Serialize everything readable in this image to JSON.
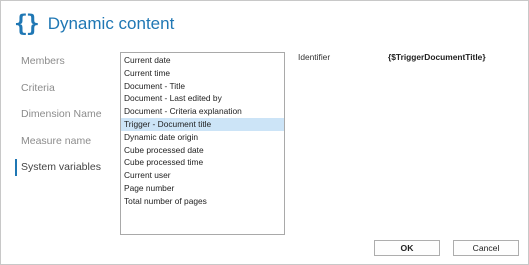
{
  "header": {
    "icon": "curly-braces-icon",
    "icon_glyph": "{}",
    "title": "Dynamic content",
    "accent_color": "#1f77b4"
  },
  "nav": {
    "items": [
      {
        "label": "Members"
      },
      {
        "label": "Criteria"
      },
      {
        "label": "Dimension Name"
      },
      {
        "label": "Measure name"
      },
      {
        "label": "System variables",
        "active": true
      }
    ]
  },
  "variables": {
    "selected_index": 5,
    "items": [
      {
        "label": "Current date"
      },
      {
        "label": "Current time"
      },
      {
        "label": "Document - Title"
      },
      {
        "label": "Document - Last edited by"
      },
      {
        "label": "Document - Criteria explanation"
      },
      {
        "label": "Trigger - Document title"
      },
      {
        "label": "Dynamic date origin"
      },
      {
        "label": "Cube processed date"
      },
      {
        "label": "Cube processed time"
      },
      {
        "label": "Current user"
      },
      {
        "label": "Page number"
      },
      {
        "label": "Total number of pages"
      }
    ]
  },
  "detail": {
    "identifier_label": "Identifier",
    "identifier_value": "{$TriggerDocumentTitle}"
  },
  "buttons": {
    "ok_label": "OK",
    "cancel_label": "Cancel"
  }
}
